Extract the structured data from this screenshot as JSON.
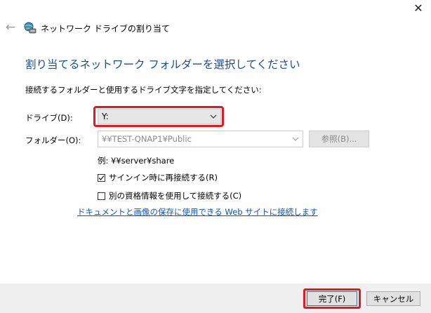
{
  "window": {
    "title": "ネットワーク ドライブの割り当て",
    "close_glyph": "✕",
    "back_glyph": "←"
  },
  "main": {
    "heading": "割り当てるネットワーク フォルダーを選択してください",
    "description": "接続するフォルダーと使用するドライブ文字を指定してください:"
  },
  "drive": {
    "label": "ドライブ(D):",
    "value": "Y:"
  },
  "folder": {
    "label": "フォルダー(O):",
    "value": "¥¥TEST-QNAP1¥Public",
    "browse_label": "参照(B)..."
  },
  "example_text": "例: ¥¥server¥share",
  "options": {
    "reconnect": {
      "label": "サインイン時に再接続する(R)",
      "checked": true
    },
    "other_credentials": {
      "label": "別の資格情報を使用して接続する(C)",
      "checked": false
    }
  },
  "link_text": "ドキュメントと画像の保存に使用できる Web サイトに接続します",
  "footer": {
    "finish_label": "完了(F)",
    "cancel_label": "キャンセル"
  },
  "colors": {
    "heading": "#1a4c97",
    "highlight": "#e8161e",
    "link": "#0c55c4"
  }
}
